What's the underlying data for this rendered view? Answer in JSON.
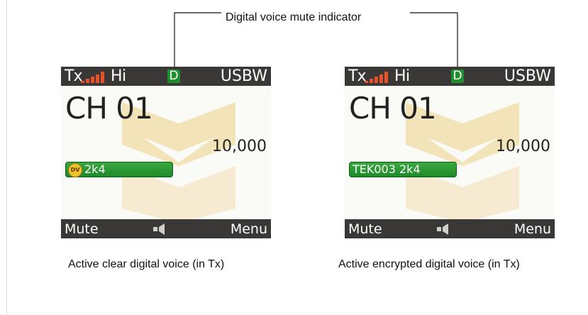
{
  "callout": {
    "label": "Digital voice mute indicator"
  },
  "screens": [
    {
      "top": {
        "tx": "Tx",
        "power": "Hi",
        "mute_indicator": "D",
        "mode": "USBW"
      },
      "channel": "CH 01",
      "frequency": "10,000",
      "voice": {
        "badge": "DV",
        "text": "2k4"
      },
      "bottom": {
        "left": "Mute",
        "right": "Menu"
      },
      "caption": "Active clear digital voice (in Tx)"
    },
    {
      "top": {
        "tx": "Tx",
        "power": "Hi",
        "mute_indicator": "D",
        "mode": "USBW"
      },
      "channel": "CH 01",
      "frequency": "10,000",
      "voice": {
        "text": "TEK003 2k4"
      },
      "bottom": {
        "left": "Mute",
        "right": "Menu"
      },
      "caption": "Active encrypted digital voice (in Tx)"
    }
  ],
  "colors": {
    "bar": "#3a3837",
    "indicator": "#1f8f2e",
    "pill": "#2a9a35",
    "signal": "#e8502a",
    "watermark": "#f3e3b8"
  }
}
